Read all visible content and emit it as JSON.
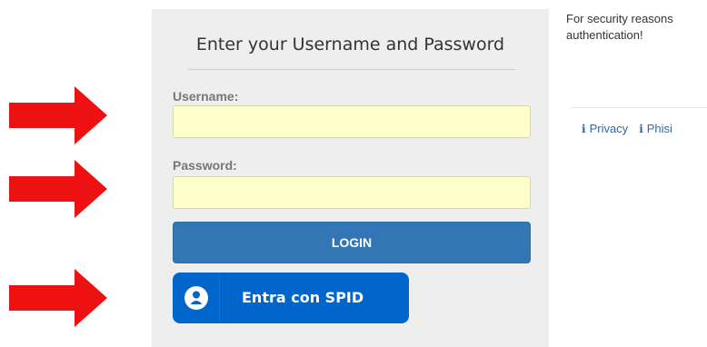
{
  "colors": {
    "arrow": "#ee1111",
    "panel_background": "#eeeeee",
    "input_background": "#ffffcc",
    "login_button": "#3376b5",
    "spid_button": "#0066cc",
    "link": "#2a6ab0"
  },
  "login_form": {
    "heading": "Enter your Username and Password",
    "username_label": "Username:",
    "username_value": "",
    "password_label": "Password:",
    "password_value": "",
    "login_button_label": "LOGIN",
    "spid_button_label": "Entra con SPID",
    "spid_icon": "user-icon"
  },
  "side_panel": {
    "security_text": "For security reasons\nauthentication!",
    "links": [
      {
        "icon": "info-icon",
        "label": "Privacy"
      },
      {
        "icon": "info-icon",
        "label": "Phisi"
      }
    ]
  },
  "annotations": {
    "arrow_icon": "right-arrow-icon",
    "arrow_targets": [
      "username",
      "password",
      "spid"
    ]
  }
}
